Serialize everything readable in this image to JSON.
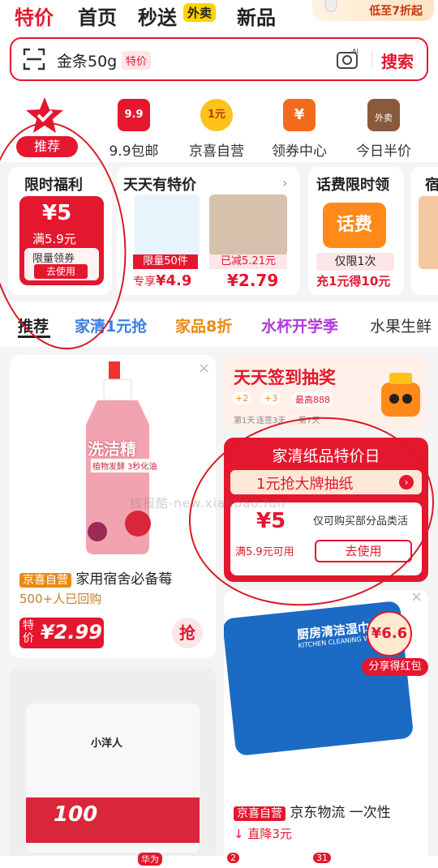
{
  "nav": {
    "tabs": [
      "特价",
      "首页",
      "秒送",
      "新品"
    ],
    "waimai_badge": "外卖",
    "promo_text": "低至7折起"
  },
  "search": {
    "text": "金条50g",
    "tag": "特价",
    "button": "搜索"
  },
  "shortcuts": {
    "recommend_label": "推荐",
    "items": [
      {
        "label": "9.9包邮",
        "icon_text": "9.9"
      },
      {
        "label": "京喜自营",
        "icon_text": "1元"
      },
      {
        "label": "领券中心",
        "icon_text": "¥"
      },
      {
        "label": "今日半价",
        "icon_text": "外卖"
      }
    ]
  },
  "cards": {
    "welfare": {
      "title": "限时福利",
      "amount": "5",
      "condition": "满5.9元",
      "note": "限量领券",
      "button": "去使用"
    },
    "daily": {
      "title": "天天有特价",
      "item1": {
        "tag": "限量50件",
        "label": "专享",
        "price": "¥4.9"
      },
      "item2": {
        "tag": "已减5.21元",
        "price": "¥2.79"
      }
    },
    "phone": {
      "title": "话费限时领",
      "icon_text": "话费",
      "tag": "仅限1次",
      "desc": "充1元得10元"
    },
    "fourth_title": "宿"
  },
  "category_tabs": [
    "推荐",
    "家清1元抢",
    "家品8折",
    "水杯开学季",
    "水果生鲜"
  ],
  "feed": {
    "product1": {
      "bottle_label": "洗洁精",
      "bottle_sub": "植物发酵 3秒化油",
      "badge": "京喜自营",
      "title": "家用宿舍必备莓",
      "bought": "500+人已回购",
      "price_label": "特价",
      "price": "¥2.99",
      "grab": "抢"
    },
    "signin": {
      "title": "天天签到抽奖",
      "b1": "+2",
      "b2": "+3",
      "b3": "最高888",
      "d1": "第1天",
      "d2": "连签3天",
      "d3": "第7天"
    },
    "paper": {
      "title": "家清纸品特价日",
      "banner": "1元抢大牌抽纸",
      "amount": "5",
      "condition": "满5.9元可用",
      "desc": "仅可购买部分品类活",
      "button": "去使用"
    },
    "product3": {
      "brand": "小洋人",
      "count": "100"
    },
    "wipes": {
      "pack_title": "厨房清洁湿巾",
      "pack_sub": "KITCHEN CLEANING WIPES",
      "price_tag": "¥6.6",
      "share": "分享得红包",
      "badge": "京喜自营",
      "title": "京东物流 一次性",
      "drop": "直降3元"
    }
  },
  "watermark": "线报酷-new.xianbao.fun",
  "bottom": {
    "huawei": "华为",
    "badge_2": "2",
    "badge_31": "31"
  }
}
